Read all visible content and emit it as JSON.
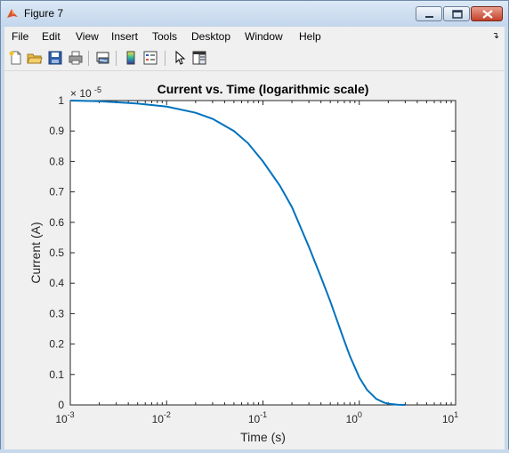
{
  "window": {
    "title": "Figure 7",
    "controls": {
      "minimize": "minimize-icon",
      "maximize": "maximize-icon",
      "close": "close-icon"
    }
  },
  "menu": {
    "items": [
      "File",
      "Edit",
      "View",
      "Insert",
      "Tools",
      "Desktop",
      "Window",
      "Help"
    ],
    "overflow_icon": "chevron-icon"
  },
  "toolbar": {
    "buttons": [
      "new-figure-icon",
      "open-file-icon",
      "save-icon",
      "print-icon",
      "link-plot-icon",
      "insert-colorbar-icon",
      "insert-legend-icon",
      "edit-plot-pointer-icon",
      "property-editor-icon"
    ]
  },
  "chart_data": {
    "type": "line",
    "title": "Current vs. Time (logarithmic scale)",
    "xlabel": "Time (s)",
    "ylabel": "Current (A)",
    "xscale": "log",
    "xlim": [
      0.001,
      10
    ],
    "ylim": [
      0,
      1e-05
    ],
    "exponent_label": "× 10",
    "exponent_power": "-5",
    "x_ticks": [
      {
        "value": 0.001,
        "base": "10",
        "power": "-3"
      },
      {
        "value": 0.01,
        "base": "10",
        "power": "-2"
      },
      {
        "value": 0.1,
        "base": "10",
        "power": "-1"
      },
      {
        "value": 1,
        "base": "10",
        "power": "0"
      },
      {
        "value": 10,
        "base": "10",
        "power": "1"
      }
    ],
    "y_ticks": [
      {
        "value": 0,
        "label": "0"
      },
      {
        "value": 0.1,
        "label": "0.1"
      },
      {
        "value": 0.2,
        "label": "0.2"
      },
      {
        "value": 0.3,
        "label": "0.3"
      },
      {
        "value": 0.4,
        "label": "0.4"
      },
      {
        "value": 0.5,
        "label": "0.5"
      },
      {
        "value": 0.6,
        "label": "0.6"
      },
      {
        "value": 0.7,
        "label": "0.7"
      },
      {
        "value": 0.8,
        "label": "0.8"
      },
      {
        "value": 0.9,
        "label": "0.9"
      },
      {
        "value": 1.0,
        "label": "1"
      }
    ],
    "series": [
      {
        "color": "#0072bd",
        "x": [
          0.001,
          0.002,
          0.005,
          0.01,
          0.02,
          0.03,
          0.05,
          0.07,
          0.1,
          0.15,
          0.2,
          0.3,
          0.4,
          0.5,
          0.6,
          0.7,
          0.8,
          1.0,
          1.2,
          1.5,
          1.8,
          2.0,
          2.5,
          2.8,
          3.0
        ],
        "y": [
          1e-05,
          9.98e-06,
          9.9e-06,
          9.8e-06,
          9.6e-06,
          9.4e-06,
          9e-06,
          8.6e-06,
          8e-06,
          7.2e-06,
          6.5e-06,
          5.2e-06,
          4.2e-06,
          3.4e-06,
          2.7e-06,
          2.1e-06,
          1.6e-06,
          9e-07,
          5e-07,
          2e-07,
          8e-08,
          4e-08,
          1e-08,
          2e-09,
          0.0
        ]
      }
    ],
    "grid": false,
    "box": true
  }
}
